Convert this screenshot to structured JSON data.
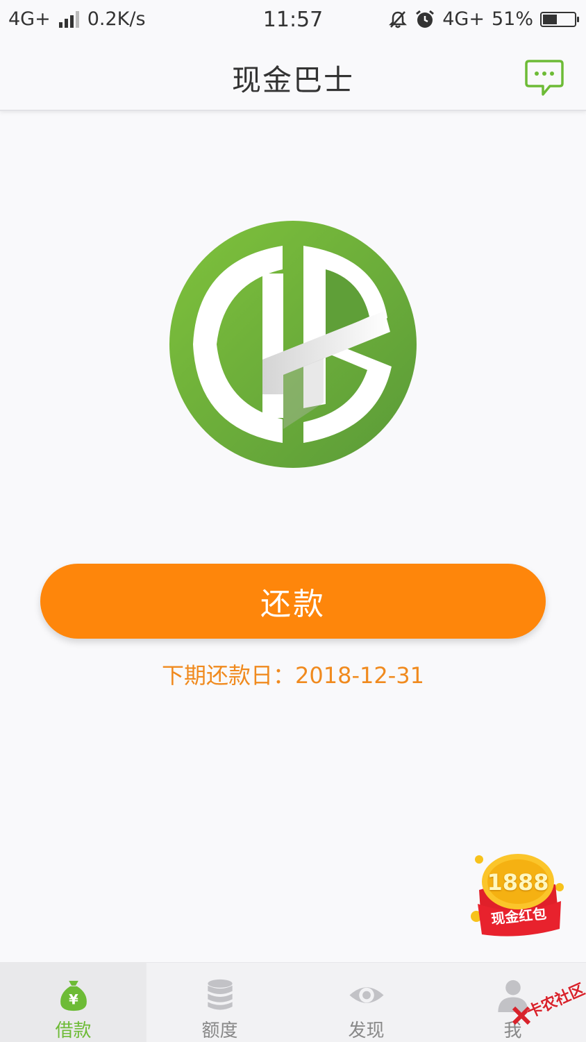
{
  "status_bar": {
    "network_left": "4G+",
    "speed": "0.2K/s",
    "time": "11:57",
    "network_right": "4G+",
    "battery": "51%",
    "battery_level": 0.51
  },
  "nav": {
    "title": "现金巴士",
    "message_icon": "chat-bubble-icon"
  },
  "main": {
    "logo_icon": "cash-bus-logo",
    "repay_label": "还款",
    "next_due_label": "下期还款日：",
    "next_due_date": "2018-12-31"
  },
  "red_packet": {
    "amount": "1888",
    "label": "现金红包"
  },
  "tabs": [
    {
      "label": "借款",
      "icon": "money-bag-icon",
      "active": true
    },
    {
      "label": "额度",
      "icon": "coin-stack-icon",
      "active": false
    },
    {
      "label": "发现",
      "icon": "eye-icon",
      "active": false
    },
    {
      "label": "我",
      "icon": "user-icon",
      "active": false
    }
  ],
  "watermark": {
    "text": "卡农社区"
  },
  "colors": {
    "brand_green": "#6dbb36",
    "accent_orange": "#fe860b",
    "due_text": "#f08a1e"
  }
}
